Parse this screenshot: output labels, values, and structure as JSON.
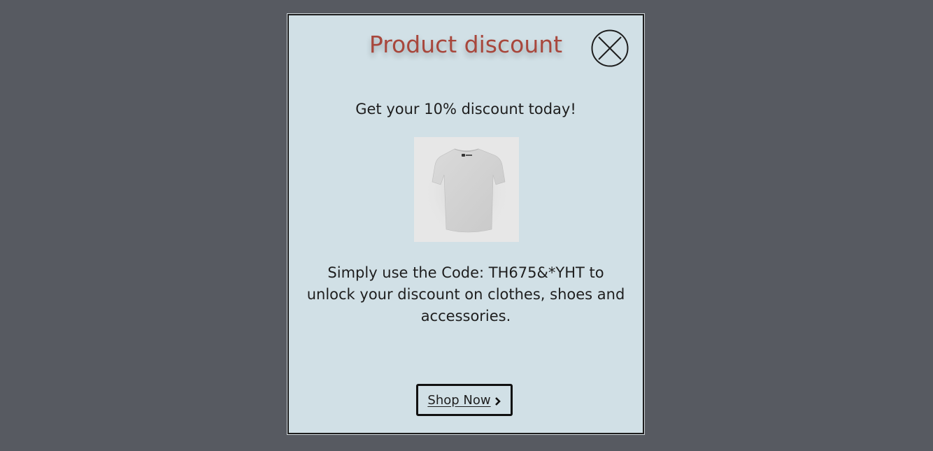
{
  "modal": {
    "title": "Product discount",
    "subtitle": "Get your 10% discount today!",
    "description": "Simply use the Code: TH675&*YHT to unlock your discount on clothes, shoes and accessories.",
    "shop_button_label": "Shop Now",
    "close_icon": "close-circle-icon",
    "shop_icon": "chevron-right-icon",
    "image_alt": "T-shirt"
  },
  "colors": {
    "backdrop": "#575a61",
    "modal_bg": "#d1e0e6",
    "title": "#a8473c",
    "text": "#1e1e1e"
  }
}
